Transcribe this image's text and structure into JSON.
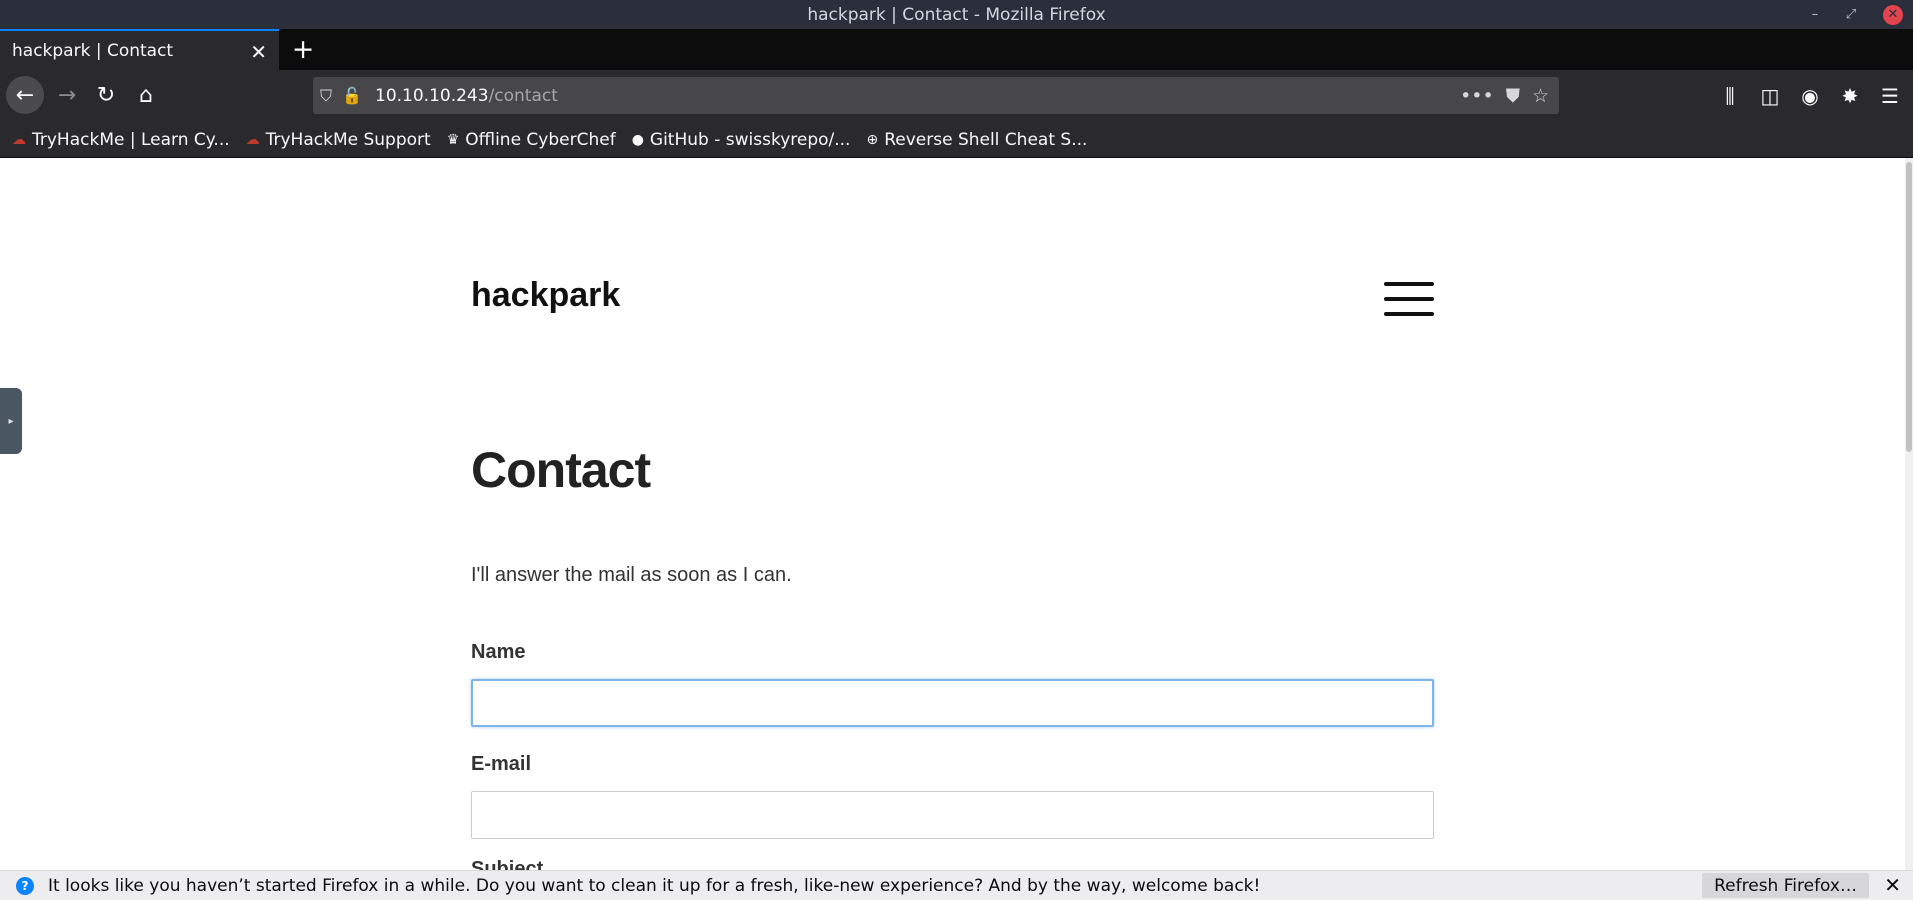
{
  "window": {
    "title": "hackpark | Contact - Mozilla Firefox",
    "min_glyph": "–",
    "max_glyph": "⤢",
    "close_glyph": "✕"
  },
  "tabs": [
    {
      "label": "hackpark | Contact",
      "close_glyph": "✕"
    }
  ],
  "new_tab_glyph": "+",
  "nav": {
    "back_glyph": "←",
    "forward_glyph": "→",
    "reload_glyph": "↻",
    "home_glyph": "⌂",
    "url_host": "10.10.10.243",
    "url_path": "/contact",
    "shield_glyph": "⛉",
    "insecure_glyph": "🔓",
    "more_glyph": "•••",
    "pocket_glyph": "⛊",
    "star_glyph": "☆"
  },
  "toolbar_icons": {
    "library": "⫼",
    "sidebar": "◫",
    "account": "◉",
    "extension": "✸",
    "menu": "☰"
  },
  "bookmarks": [
    {
      "label": "TryHackMe | Learn Cy...",
      "icon": "☁",
      "icon_name": "tryhackme-icon"
    },
    {
      "label": "TryHackMe Support",
      "icon": "☁",
      "icon_name": "tryhackme-support-icon"
    },
    {
      "label": "Offline CyberChef",
      "icon": "♛",
      "icon_name": "cyberchef-icon"
    },
    {
      "label": "GitHub - swisskyrepo/...",
      "icon": "●",
      "icon_name": "github-icon"
    },
    {
      "label": "Reverse Shell Cheat S...",
      "icon": "⊕",
      "icon_name": "globe-icon"
    }
  ],
  "page": {
    "site_title": "hackpark",
    "heading": "Contact",
    "intro": "I'll answer the mail as soon as I can.",
    "form": {
      "name_label": "Name",
      "name_value": "",
      "email_label": "E-mail",
      "email_value": "",
      "subject_label": "Subject"
    },
    "side_handle_glyph": "▸"
  },
  "notification": {
    "icon": "?",
    "message": "It looks like you haven’t started Firefox in a while. Do you want to clean it up for a fresh, like-new experience? And by the way, welcome back!",
    "button_label": "Refresh Firefox…",
    "close_glyph": "✕"
  },
  "colors": {
    "accent": "#0a84ff",
    "titlebar": "#2b2e3b",
    "toolbar": "#2a2a2e",
    "focus_ring": "#7fb5ea"
  }
}
